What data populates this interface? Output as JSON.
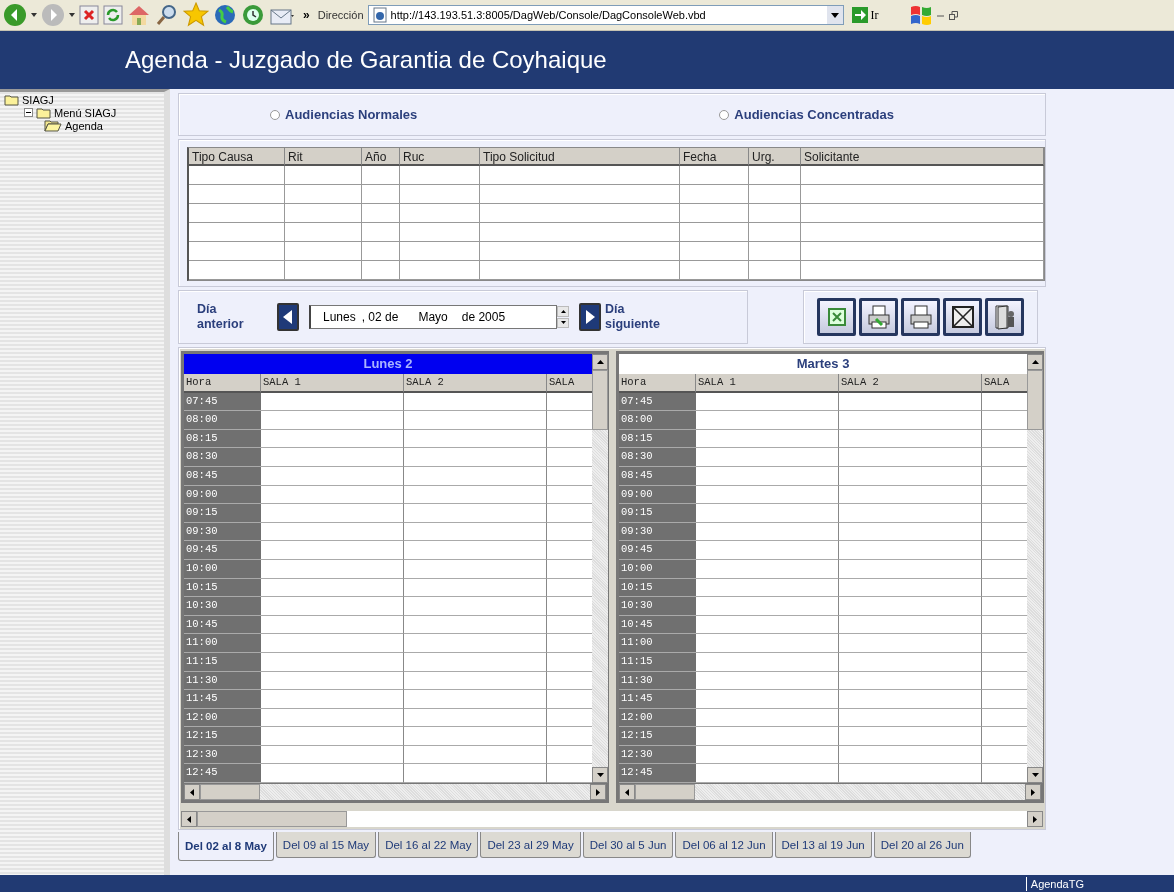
{
  "toolbar": {
    "more": "»",
    "address_label": "Dirección",
    "url": "http://143.193.51.3:8005/DagWeb/Console/DagConsoleWeb.vbd",
    "go_label": "Ir"
  },
  "window": {
    "title": "Agenda - Juzgado de Garantia de Coyhaique"
  },
  "sidebar": {
    "tree": [
      {
        "label": "SIAGJ",
        "open": false,
        "children": [
          {
            "label": "Menú SIAGJ",
            "open": false,
            "children": [
              {
                "label": "Agenda",
                "open": true
              }
            ]
          }
        ]
      }
    ]
  },
  "modes": [
    {
      "label": "Audiencias Normales",
      "selected": false
    },
    {
      "label": "Audiencias Concentradas",
      "selected": false
    }
  ],
  "requests": {
    "columns": [
      "Tipo Causa",
      "Rit",
      "Año",
      "Ruc",
      "Tipo Solicitud",
      "Fecha",
      "Urg.",
      "Solicitante"
    ]
  },
  "date_nav": {
    "prev_label": [
      "Día",
      "anterior"
    ],
    "next_label": [
      "Día",
      "siguiente"
    ],
    "weekday": "Lunes",
    "day": ", 02 de",
    "month": "Mayo",
    "year": "de 2005"
  },
  "days": [
    {
      "title": "Lunes 2",
      "selected": true,
      "hour_label": "Hora",
      "rooms": [
        "SALA 1",
        "SALA 2",
        "SALA"
      ],
      "times": [
        "07:45",
        "08:00",
        "08:15",
        "08:30",
        "08:45",
        "09:00",
        "09:15",
        "09:30",
        "09:45",
        "10:00",
        "10:15",
        "10:30",
        "10:45",
        "11:00",
        "11:15",
        "11:30",
        "11:45",
        "12:00",
        "12:15",
        "12:30",
        "12:45"
      ]
    },
    {
      "title": "Martes 3",
      "selected": false,
      "hour_label": "Hora",
      "rooms": [
        "SALA 1",
        "SALA 2",
        "SALA"
      ],
      "times": [
        "07:45",
        "08:00",
        "08:15",
        "08:30",
        "08:45",
        "09:00",
        "09:15",
        "09:30",
        "09:45",
        "10:00",
        "10:15",
        "10:30",
        "10:45",
        "11:00",
        "11:15",
        "11:30",
        "11:45",
        "12:00",
        "12:15",
        "12:30",
        "12:45"
      ]
    }
  ],
  "week_tabs": [
    {
      "label": "Del 02 al 8 May",
      "selected": true
    },
    {
      "label": "Del 09 al 15 May",
      "selected": false
    },
    {
      "label": "Del 16 al 22 May",
      "selected": false
    },
    {
      "label": "Del 23 al 29 May",
      "selected": false
    },
    {
      "label": "Del 30 al 5 Jun",
      "selected": false
    },
    {
      "label": "Del 06 al 12 Jun",
      "selected": false
    },
    {
      "label": "Del 13 al 19 Jun",
      "selected": false
    },
    {
      "label": "Del 20 al 26 Jun",
      "selected": false
    }
  ],
  "status_bar": {
    "app": "AgendaTG"
  }
}
